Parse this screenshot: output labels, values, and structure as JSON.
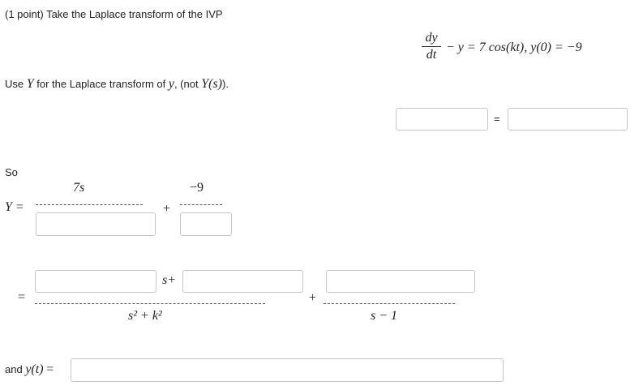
{
  "problem": {
    "heading": "(1 point) Take the Laplace transform of the IVP",
    "ode_numer": "dy",
    "ode_denom": "dt",
    "ode_rest": "− y = 7 cos(kt), y(0) = −9",
    "use_prefix": "Use ",
    "use_Y": "Y",
    "use_mid": " for the Laplace transform of ",
    "use_y": "y",
    "use_comma": ", (not ",
    "use_Ys": "Y(s)",
    "use_end": ")."
  },
  "equation_row": {
    "equals": "=",
    "left_value": "",
    "right_value": ""
  },
  "so_label": "So",
  "y_row": {
    "lhs": "Y =",
    "numerator1": "7s",
    "plus": "+",
    "numerator2": "−9",
    "denom1_value": "",
    "denom2_value": ""
  },
  "partial_row": {
    "equals": "=",
    "coef_a_value": "",
    "s_plus": "s+",
    "coef_b_value": "",
    "plus": "+",
    "coef_c_value": "",
    "denom1": "s² + k²",
    "denom2": "s − 1"
  },
  "answer": {
    "prefix": "and ",
    "func": "y(t)",
    "equals": "=",
    "value": ""
  }
}
